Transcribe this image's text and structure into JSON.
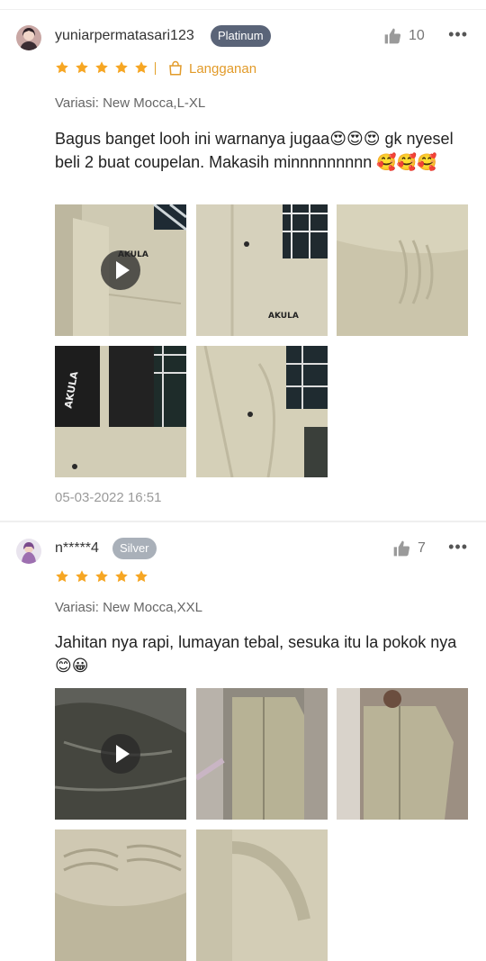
{
  "reviews": [
    {
      "username": "yuniarpermatasari123",
      "badge": "Platinum",
      "likes": "10",
      "rating": 5,
      "subscription": "Langganan",
      "variant": "Variasi: New Mocca,L-XL",
      "comment": "Bagus banget looh ini warnanya jugaa😍😍😍 gk nyesel beli 2 buat coupelan. Makasih minnnnnnnnn 🥰🥰🥰",
      "date": "05-03-2022 16:51",
      "thumbnails": [
        {
          "kind": "video",
          "label": "AKULA"
        },
        {
          "kind": "image",
          "label": "AKULA"
        },
        {
          "kind": "image",
          "label": ""
        },
        {
          "kind": "image",
          "label": "AKULA"
        },
        {
          "kind": "image",
          "label": ""
        }
      ]
    },
    {
      "username": "n*****4",
      "badge": "Silver",
      "likes": "7",
      "rating": 5,
      "variant": "Variasi: New Mocca,XXL",
      "comment": "Jahitan nya rapi, lumayan tebal, sesuka itu la pokok nya 😊😀",
      "thumbnails": [
        {
          "kind": "video"
        },
        {
          "kind": "image"
        },
        {
          "kind": "image"
        },
        {
          "kind": "image"
        },
        {
          "kind": "image"
        }
      ]
    }
  ],
  "icons": {
    "like": "thumbs-up-icon",
    "more": "more-dots-icon",
    "subscription": "shopping-bag-icon",
    "play": "play-icon",
    "star": "star-icon"
  },
  "colors": {
    "star": "#f6a623",
    "accent": "#e29b2a",
    "badge_platinum": "#5a6478",
    "badge_silver": "#a9b0b9"
  }
}
